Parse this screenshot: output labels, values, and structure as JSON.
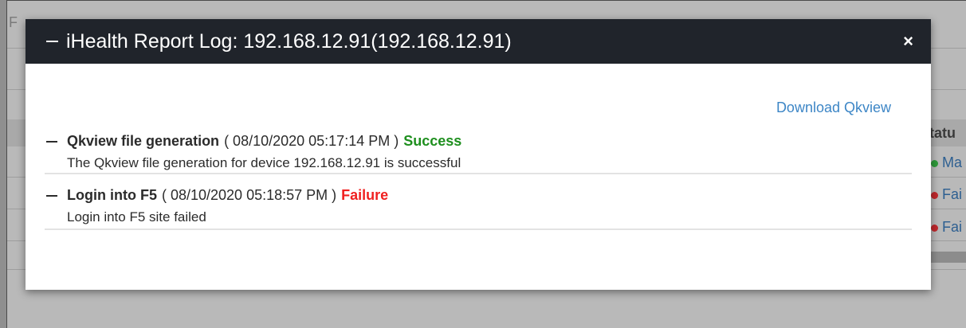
{
  "background": {
    "corner_letter": "F",
    "status_header": "tatu",
    "status_rows": [
      {
        "label": "Ma",
        "color": "#2e9a3a"
      },
      {
        "label": "Fai",
        "color": "#c0282d"
      },
      {
        "label": "Fai",
        "color": "#c0282d"
      }
    ]
  },
  "modal": {
    "title": "iHealth Report Log: 192.168.12.91(192.168.12.91)",
    "close_glyph": "×",
    "download_label": "Download Qkview",
    "entries": [
      {
        "title": "Qkview file generation",
        "time": "( 08/10/2020 05:17:14 PM )",
        "status": "Success",
        "status_color": "#1e8f1e",
        "description": "The Qkview file generation for device 192.168.12.91 is successful"
      },
      {
        "title": "Login into F5",
        "time": "( 08/10/2020 05:18:57 PM )",
        "status": "Failure",
        "status_color": "#f02020",
        "description": "Login into F5 site failed"
      }
    ]
  },
  "colors": {
    "header_bg": "#20242b",
    "link": "#3d86c6",
    "overlay": "#8f8f8f"
  }
}
